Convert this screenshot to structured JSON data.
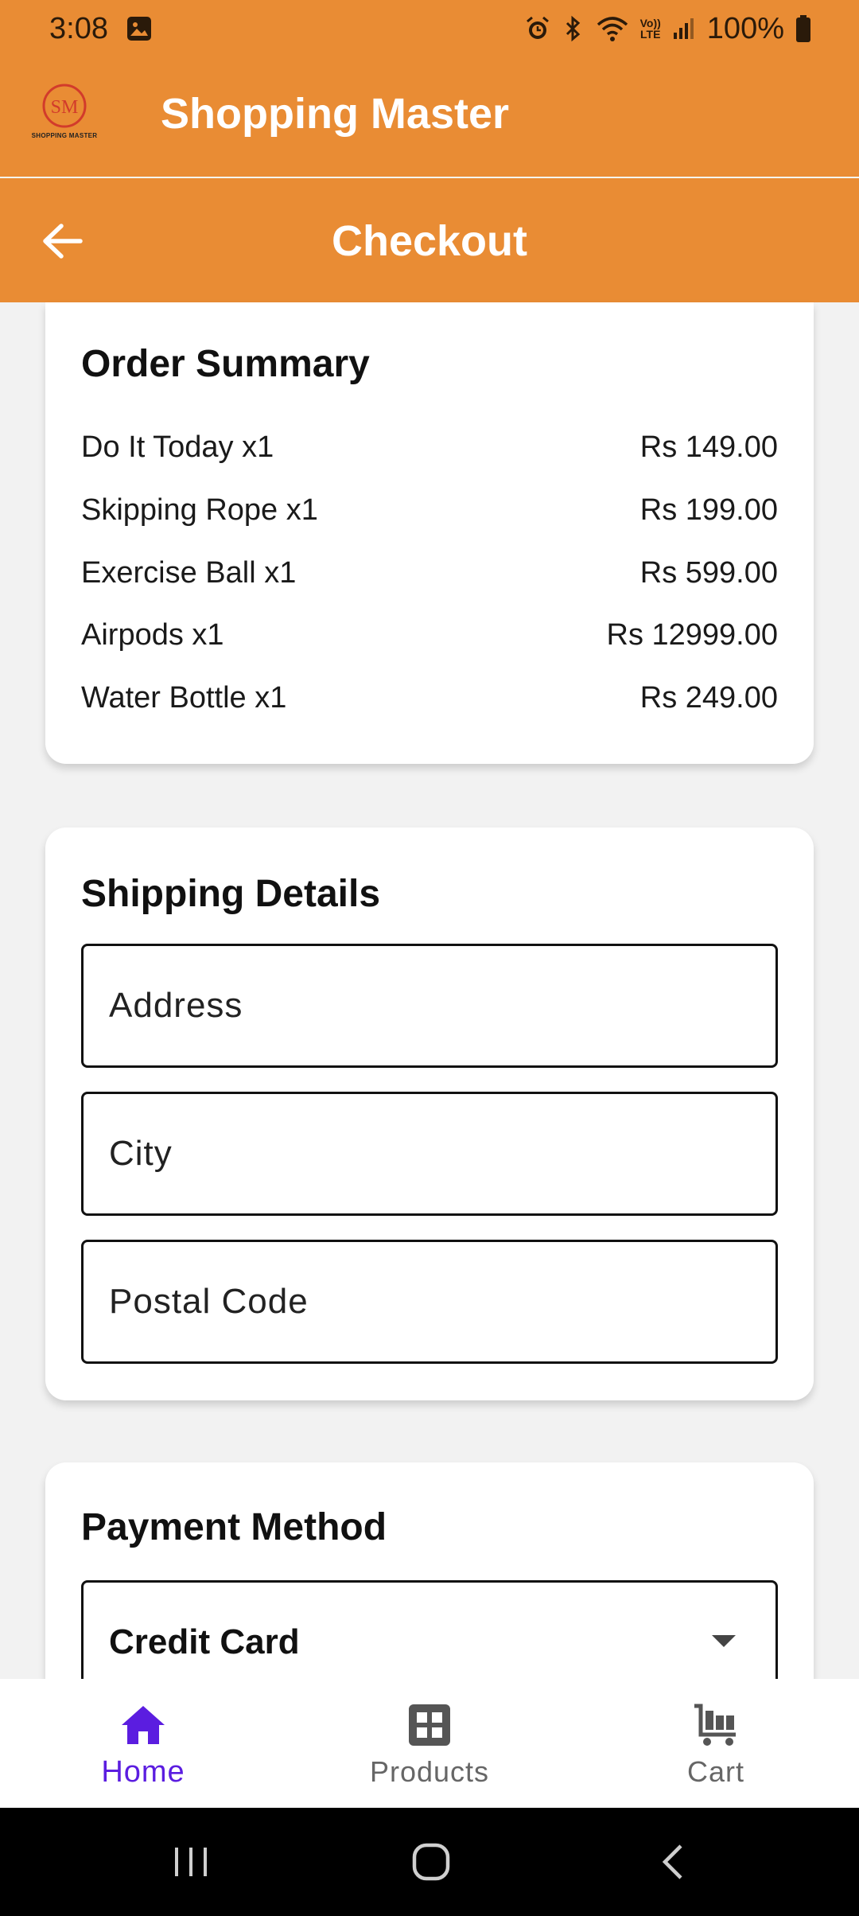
{
  "status_bar": {
    "time": "3:08",
    "battery": "100%",
    "network_label": "LTE"
  },
  "app_bar": {
    "title": "Shopping Master",
    "logo_caption": "SHOPPING MASTER",
    "logo_monogram": "SM"
  },
  "checkout": {
    "title": "Checkout"
  },
  "order_summary": {
    "title": "Order Summary",
    "items": [
      {
        "name": "Do It Today x1",
        "price": "Rs 149.00"
      },
      {
        "name": "Skipping Rope x1",
        "price": "Rs 199.00"
      },
      {
        "name": "Exercise Ball x1",
        "price": "Rs 599.00"
      },
      {
        "name": "Airpods x1",
        "price": "Rs 12999.00"
      },
      {
        "name": "Water Bottle x1",
        "price": "Rs 249.00"
      }
    ]
  },
  "shipping": {
    "title": "Shipping Details",
    "address_placeholder": "Address",
    "city_placeholder": "City",
    "postal_placeholder": "Postal Code"
  },
  "payment": {
    "title": "Payment Method",
    "selected": "Credit Card"
  },
  "bottom_nav": {
    "home": "Home",
    "products": "Products",
    "cart": "Cart"
  },
  "colors": {
    "accent": "#e98c34",
    "nav_active": "#5b1de0",
    "nav_inactive": "#666666"
  }
}
